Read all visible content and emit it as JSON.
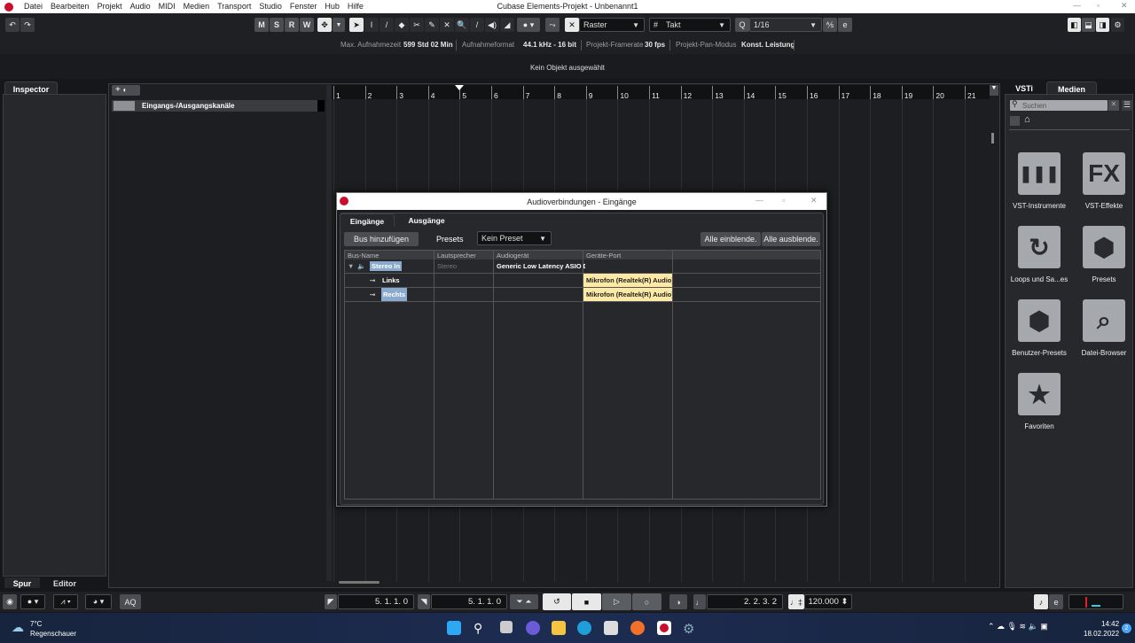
{
  "window": {
    "title": "Cubase Elements-Projekt - Unbenannt1",
    "minimize": "—",
    "maximize": "▫",
    "close": "✕"
  },
  "menu": [
    "Datei",
    "Bearbeiten",
    "Projekt",
    "Audio",
    "MIDI",
    "Medien",
    "Transport",
    "Studio",
    "Fenster",
    "Hub",
    "Hilfe"
  ],
  "toolbar": {
    "undo": "↶",
    "redo": "↷",
    "msrw": [
      "M",
      "S",
      "R",
      "W"
    ],
    "snap_mode": "Raster",
    "grid_type": "Takt",
    "quantize_label": "Q",
    "quantize": "1/16",
    "tools": [
      "➤",
      "I",
      "/",
      "◆",
      "✂",
      "✎",
      "✕",
      "🔍",
      "/",
      "◀)",
      "◢"
    ]
  },
  "info": {
    "rec_time_label": "Max. Aufnahmezeit",
    "rec_time": "599 Std 02 Min",
    "rec_format_label": "Aufnahmeformat",
    "rec_format": "44.1 kHz - 16 bit",
    "framerate_label": "Projekt-Framerate",
    "framerate": "30 fps",
    "pan_label": "Projekt-Pan-Modus",
    "pan": "Konst. Leistung"
  },
  "status": "Kein Objekt ausgewählt",
  "inspector": {
    "tab": "Inspector",
    "bottom_tabs": [
      "Spur",
      "Editor"
    ]
  },
  "tracklist": {
    "add": "+",
    "track_name": "Eingangs-/Ausgangskanäle"
  },
  "ruler": [
    "1",
    "2",
    "3",
    "4",
    "5",
    "6",
    "7",
    "8",
    "9",
    "10",
    "11",
    "12",
    "13",
    "14",
    "15",
    "16",
    "17",
    "18",
    "19",
    "20",
    "21"
  ],
  "dialog": {
    "title": "Audioverbindungen - Eingänge",
    "tabs": [
      "Eingänge",
      "Ausgänge"
    ],
    "add_bus": "Bus hinzufügen",
    "presets_label": "Presets",
    "preset": "Kein Preset",
    "expand_all": "Alle einblende.",
    "collapse_all": "Alle ausblende.",
    "columns": [
      "Bus-Name",
      "Lautsprecher",
      "Audiogerät",
      "Geräte-Port"
    ],
    "rows": [
      {
        "name": "Stereo In",
        "speaker": "Stereo",
        "device": "Generic Low Latency ASIO D",
        "port": ""
      },
      {
        "name": "Links",
        "speaker": "",
        "device": "",
        "port": "Mikrofon (Realtek(R) Audio)"
      },
      {
        "name": "Rechts",
        "speaker": "",
        "device": "",
        "port": "Mikrofon (Realtek(R) Audio)"
      }
    ]
  },
  "right_panel": {
    "tabs": [
      "VSTi",
      "Medien"
    ],
    "search_placeholder": "Suchen",
    "items": [
      {
        "label": "VST-Instrumente",
        "icon": "piano-icon"
      },
      {
        "label": "VST-Effekte",
        "icon": "FX"
      },
      {
        "label": "Loops und Sa...es",
        "icon": "loop-icon"
      },
      {
        "label": "Presets",
        "icon": "hexagons-icon"
      },
      {
        "label": "Benutzer-Presets",
        "icon": "user-preset-icon"
      },
      {
        "label": "Datei-Browser",
        "icon": "file-browser-icon"
      },
      {
        "label": "Favoriten",
        "icon": "star-icon"
      }
    ]
  },
  "transport": {
    "aq": "AQ",
    "left_locator": "5. 1. 1.   0",
    "right_locator": "5. 1. 1.   0",
    "position": "2. 2. 3.   2",
    "tempo": "120.000"
  },
  "taskbar": {
    "temp": "7°C",
    "weather": "Regenschauer",
    "time": "14:42",
    "date": "18.02.2022",
    "notifications": "2"
  }
}
